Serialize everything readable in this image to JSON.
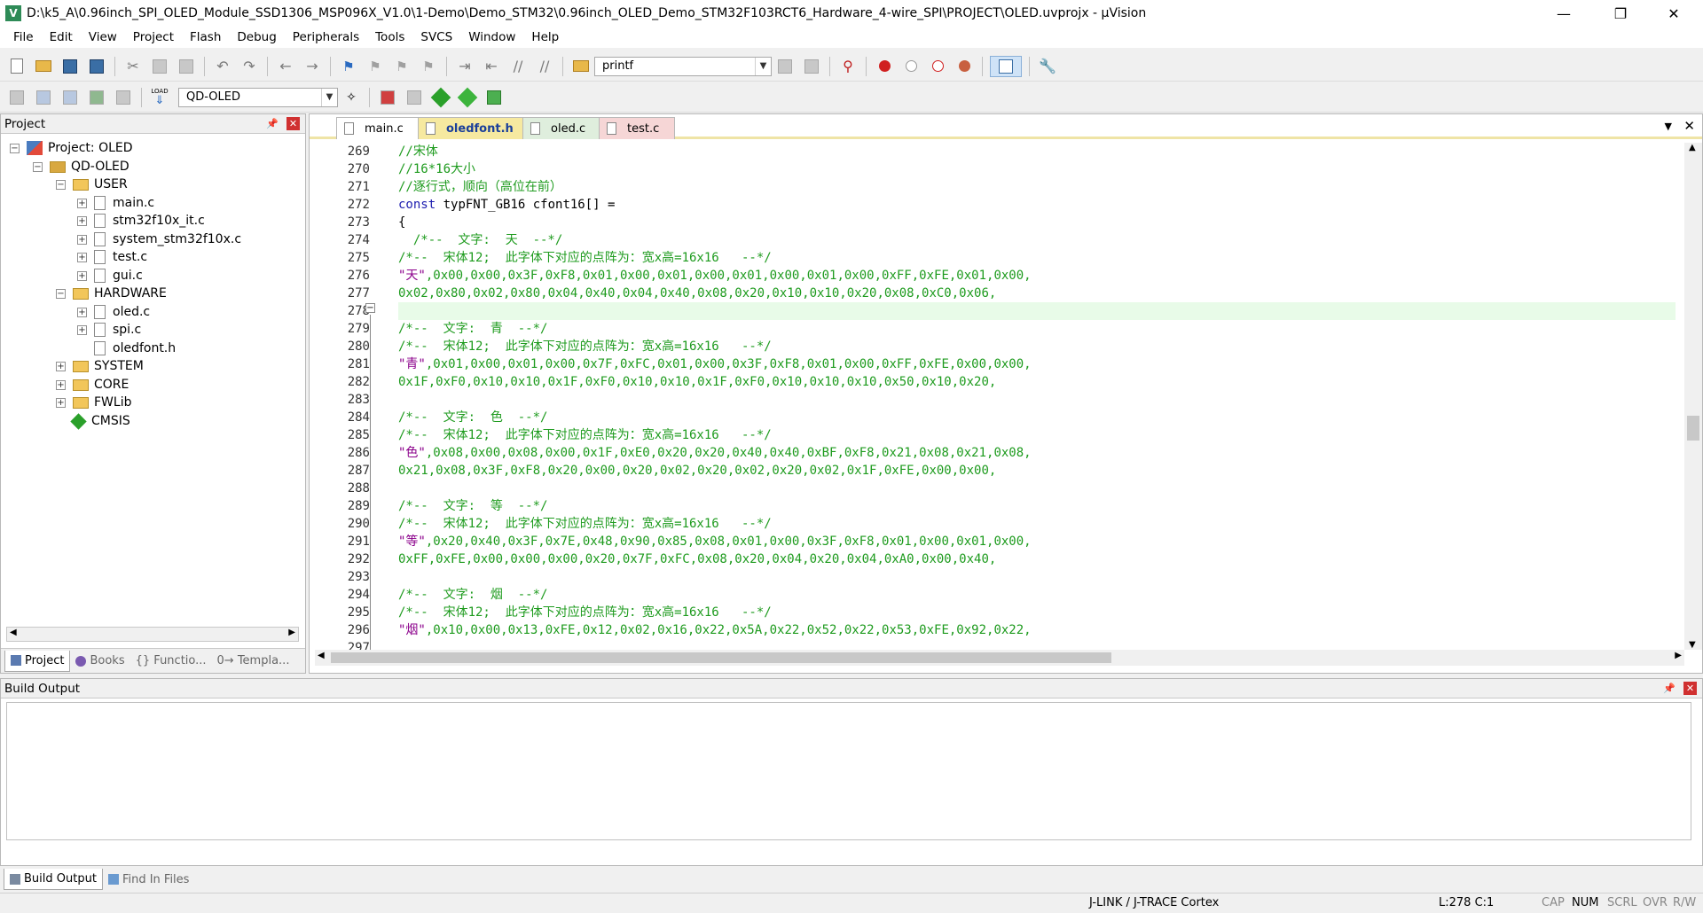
{
  "window": {
    "title": "D:\\k5_A\\0.96inch_SPI_OLED_Module_SSD1306_MSP096X_V1.0\\1-Demo\\Demo_STM32\\0.96inch_OLED_Demo_STM32F103RCT6_Hardware_4-wire_SPI\\PROJECT\\OLED.uvprojx - µVision",
    "icon_letter": "V"
  },
  "menu": [
    "File",
    "Edit",
    "View",
    "Project",
    "Flash",
    "Debug",
    "Peripherals",
    "Tools",
    "SVCS",
    "Window",
    "Help"
  ],
  "toolbar": {
    "find_combo_value": "printf",
    "target_combo_value": "QD-OLED",
    "load_label": "LOAD"
  },
  "project_panel": {
    "title": "Project",
    "tree": {
      "project": "Project: OLED",
      "target": "QD-OLED",
      "user": "USER",
      "user_files": [
        "main.c",
        "stm32f10x_it.c",
        "system_stm32f10x.c",
        "test.c",
        "gui.c"
      ],
      "hardware": "HARDWARE",
      "hardware_files": [
        "oled.c",
        "spi.c",
        "oledfont.h"
      ],
      "system": "SYSTEM",
      "core": "CORE",
      "fwlib": "FWLib",
      "cmsis": "CMSIS"
    },
    "tabs": [
      "Project",
      "Books",
      "{} Functio...",
      "0→ Templa..."
    ]
  },
  "editor": {
    "tabs": [
      "main.c",
      "oledfont.h",
      "oled.c",
      "test.c"
    ],
    "active_tab": "oledfont.h",
    "line_numbers": [
      "269",
      "270",
      "271",
      "272",
      "273",
      "274",
      "275",
      "276",
      "277",
      "278",
      "279",
      "280",
      "281",
      "282",
      "283",
      "284",
      "285",
      "286",
      "287",
      "288",
      "289",
      "290",
      "291",
      "292",
      "293",
      "294",
      "295",
      "296",
      "297"
    ],
    "lines": {
      "l269": "//宋体",
      "l270": "//16*16大小",
      "l271": "//逐行式，顺向（高位在前）",
      "l272_kw": "const",
      "l272_rest": " typFNT_GB16 cfont16[] =",
      "l273": "{",
      "l274": "  /*--  文字:  天  --*/",
      "l275": "/*--  宋体12;  此字体下对应的点阵为：宽x高=16x16   --*/",
      "l276_str": "\"天\"",
      "l276_hex": ",0x00,0x00,0x3F,0xF8,0x01,0x00,0x01,0x00,0x01,0x00,0x01,0x00,0xFF,0xFE,0x01,0x00,",
      "l277_hex": "0x02,0x80,0x02,0x80,0x04,0x40,0x04,0x40,0x08,0x20,0x10,0x10,0x20,0x08,0xC0,0x06,",
      "l279": "/*--  文字:  青  --*/",
      "l280": "/*--  宋体12;  此字体下对应的点阵为：宽x高=16x16   --*/",
      "l281_str": "\"青\"",
      "l281_hex": ",0x01,0x00,0x01,0x00,0x7F,0xFC,0x01,0x00,0x3F,0xF8,0x01,0x00,0xFF,0xFE,0x00,0x00,",
      "l282_hex": "0x1F,0xF0,0x10,0x10,0x1F,0xF0,0x10,0x10,0x1F,0xF0,0x10,0x10,0x10,0x50,0x10,0x20,",
      "l284": "/*--  文字:  色  --*/",
      "l285": "/*--  宋体12;  此字体下对应的点阵为：宽x高=16x16   --*/",
      "l286_str": "\"色\"",
      "l286_hex": ",0x08,0x00,0x08,0x00,0x1F,0xE0,0x20,0x20,0x40,0x40,0xBF,0xF8,0x21,0x08,0x21,0x08,",
      "l287_hex": "0x21,0x08,0x3F,0xF8,0x20,0x00,0x20,0x02,0x20,0x02,0x20,0x02,0x1F,0xFE,0x00,0x00,",
      "l289": "/*--  文字:  等  --*/",
      "l290": "/*--  宋体12;  此字体下对应的点阵为：宽x高=16x16   --*/",
      "l291_str": "\"等\"",
      "l291_hex": ",0x20,0x40,0x3F,0x7E,0x48,0x90,0x85,0x08,0x01,0x00,0x3F,0xF8,0x01,0x00,0x01,0x00,",
      "l292_hex": "0xFF,0xFE,0x00,0x00,0x00,0x20,0x7F,0xFC,0x08,0x20,0x04,0x20,0x04,0xA0,0x00,0x40,",
      "l294": "/*--  文字:  烟  --*/",
      "l295": "/*--  宋体12;  此字体下对应的点阵为：宽x高=16x16   --*/",
      "l296_str": "\"烟\"",
      "l296_hex": ",0x10,0x00,0x13,0xFE,0x12,0x02,0x16,0x22,0x5A,0x22,0x52,0x22,0x53,0xFE,0x92,0x22,"
    }
  },
  "build_panel": {
    "title": "Build Output",
    "tabs": [
      "Build Output",
      "Find In Files"
    ]
  },
  "status_bar": {
    "debugger": "J-LINK / J-TRACE Cortex",
    "position": "L:278 C:1",
    "cap": "CAP",
    "num": "NUM",
    "scrl": "SCRL",
    "ovr": "OVR",
    "rw": "R/W"
  },
  "colors": {
    "comment": "#1e9b1e",
    "keyword": "#2020b0",
    "string": "#8b008b",
    "active_tab_bg": "#f6e9a0",
    "current_line": "#e8fbe8"
  }
}
